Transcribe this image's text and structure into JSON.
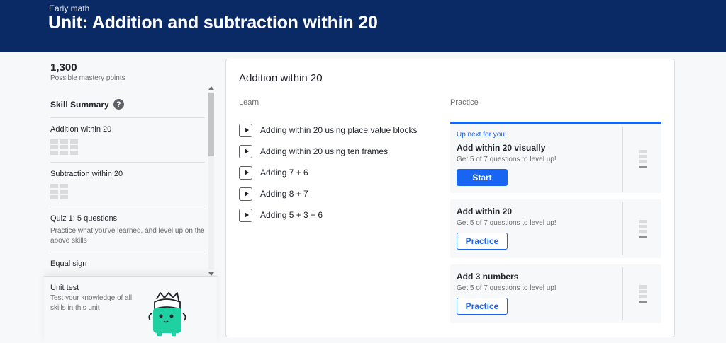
{
  "header": {
    "breadcrumb": "Early math",
    "title": "Unit: Addition and subtraction within 20",
    "background_color": "#0a2a66"
  },
  "sidebar": {
    "points_value": "1,300",
    "points_label": "Possible mastery points",
    "skill_summary_label": "Skill Summary",
    "help_icon_glyph": "?",
    "items": [
      {
        "label": "Addition within 20",
        "mastery_cells": 3
      },
      {
        "label": "Subtraction within 20",
        "mastery_cells": 2
      },
      {
        "label": "Quiz 1: 5 questions",
        "description": "Practice what you've learned, and level up on the above skills"
      },
      {
        "label": "Equal sign"
      }
    ],
    "unit_test": {
      "label": "Unit test",
      "description": "Test your knowledge of all skills in this unit"
    }
  },
  "main": {
    "section_title": "Addition within 20",
    "learn_header": "Learn",
    "practice_header": "Practice",
    "learn_items": [
      {
        "label": "Adding within 20 using place value blocks"
      },
      {
        "label": "Adding within 20 using ten frames"
      },
      {
        "label": "Adding 7 + 6"
      },
      {
        "label": "Adding 8 + 7"
      },
      {
        "label": "Adding 5 + 3 + 6"
      }
    ],
    "practice_cards": [
      {
        "up_next": "Up next for you:",
        "title": "Add within 20 visually",
        "subtitle": "Get 5 of 7 questions to level up!",
        "button": "Start"
      },
      {
        "title": "Add within 20",
        "subtitle": "Get 5 of 7 questions to level up!",
        "button": "Practice"
      },
      {
        "title": "Add 3 numbers",
        "subtitle": "Get 5 of 7 questions to level up!",
        "button": "Practice"
      }
    ]
  },
  "colors": {
    "accent_blue": "#1865f2",
    "mascot_green": "#1fd1a1"
  }
}
